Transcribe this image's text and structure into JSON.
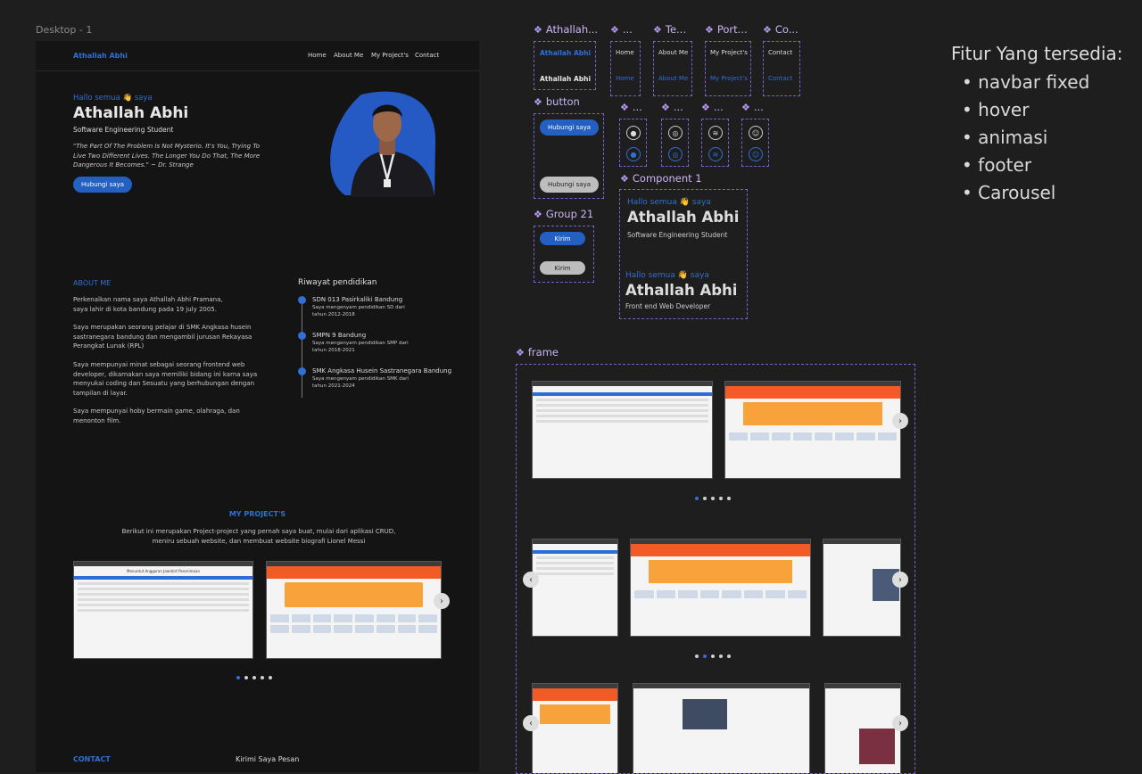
{
  "canvas": {
    "frame_label": "Desktop - 1",
    "features_title": "Fitur Yang tersedia:",
    "features": [
      "navbar fixed",
      "hover",
      "animasi",
      "footer",
      "Carousel"
    ]
  },
  "site": {
    "brand": "Athallah Abhi",
    "nav": [
      "Home",
      "About Me",
      "My Project's",
      "Contact"
    ],
    "hero": {
      "greeting": "Hallo semua 👋 saya",
      "name": "Athallah Abhi",
      "role": "Software Engineering Student",
      "quote": "\"The Part Of The Problem Is Not Mysterio. It's You, Trying To Live Two Different Lives. The Longer You Do That, The More Dangerous It Becomes.\" ~ Dr. Strange",
      "cta": "Hubungi saya"
    },
    "about": {
      "title": "ABOUT ME",
      "p1": "Perkenalkan nama saya Athallah Abhi Pramana, saya lahir di kota bandung pada 19 july 2005.",
      "p2": "Saya merupakan seorang pelajar di SMK Angkasa husein sastranegara bandung dan mengambil jurusan Rekayasa Perangkat Lunak (RPL)",
      "p3": "Saya mempunyai minat sebagai seorang frontend web developer, dikarnakan saya memiliki bidang ini karna saya menyukai coding dan Sesuatu yang berhubungan dengan tampilan di layar.",
      "p4": "Saya mempunyai hoby bermain game, olahraga, dan menonton film."
    },
    "education": {
      "title": "Riwayat pendidikan",
      "items": [
        {
          "school": "SDN 013 Pasirkaliki Bandung",
          "desc": "Saya mengenyam pendidikan SD dari tahun 2012-2018"
        },
        {
          "school": "SMPN 9 Bandung",
          "desc": "Saya mengenyam pendidikan SMP dari tahun 2018-2021"
        },
        {
          "school": "SMK Angkasa Husein Sastranegara Bandung",
          "desc": "Saya mengenyam pendidikan SMK dari tahun 2021-2024"
        }
      ]
    },
    "projects": {
      "title": "MY PROJECT'S",
      "desc": "Berikut ini merupakan Project-project yang pernah saya buat, mulai dari aplikasi CRUD, meniru sebuah website, dan membuat website biografi Lionel Messi",
      "crud_title": "Menuntut Anggaran Jaambrt Penerimaan",
      "next": "›"
    },
    "contact": {
      "title": "CONTACT",
      "form_title": "Kirimi Saya Pesan"
    }
  },
  "components": {
    "labels": {
      "athallah": "Athallah...",
      "home": "...",
      "te": "Te...",
      "port": "Port...",
      "co": "Co...",
      "button": "button",
      "social1": "...",
      "social2": "...",
      "social3": "...",
      "social4": "...",
      "component1": "Component 1",
      "group21": "Group 21",
      "frame": "frame"
    },
    "brand_a": "Athallah Abhi",
    "brand_b": "Athallah Abhi",
    "nav_home": "Home",
    "nav_about": "About Me",
    "nav_project": "My Project's",
    "nav_contact": "Contact",
    "btn_hubungi_a": "Hubungi saya",
    "btn_hubungi_b": "Hubungi saya",
    "btn_kirim_a": "Kirim",
    "btn_kirim_b": "Kirim",
    "comp1": {
      "greet_a": "Hallo semua 👋 saya",
      "name_a": "Athallah Abhi",
      "role_a": "Software Engineering Student",
      "greet_b": "Hallo semua 👋 saya",
      "name_b": "Athallah Abhi",
      "role_b": "Front end Web Developer"
    },
    "arrows": {
      "next": "›",
      "prev": "‹"
    },
    "icons": [
      "github-icon",
      "instagram-icon",
      "spotify-icon",
      "discord-icon"
    ]
  }
}
